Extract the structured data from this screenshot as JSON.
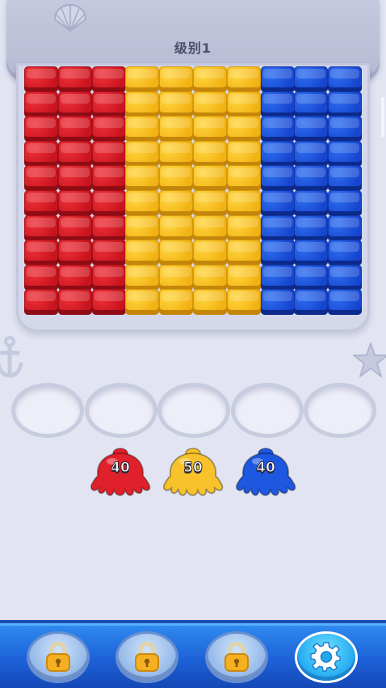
{
  "header": {
    "level_label": "级别1"
  },
  "board": {
    "columns": [
      "red",
      "red",
      "red",
      "yellow",
      "yellow",
      "yellow",
      "yellow",
      "blue",
      "blue",
      "blue"
    ],
    "rows": 10
  },
  "slots": {
    "count": 5
  },
  "octopuses": [
    {
      "color": "red",
      "count": "40"
    },
    {
      "color": "yellow",
      "count": "50"
    },
    {
      "color": "blue",
      "count": "40"
    }
  ],
  "toolbar": {
    "buttons": [
      {
        "name": "locked-slot-1",
        "icon": "lock-icon"
      },
      {
        "name": "locked-slot-2",
        "icon": "lock-icon"
      },
      {
        "name": "locked-slot-3",
        "icon": "lock-icon"
      },
      {
        "name": "settings",
        "icon": "gear-icon"
      }
    ]
  },
  "colors": {
    "red": "#e0202a",
    "yellow": "#f7c22a",
    "blue": "#1e57e0",
    "toolbar": "#1c5fd6"
  }
}
